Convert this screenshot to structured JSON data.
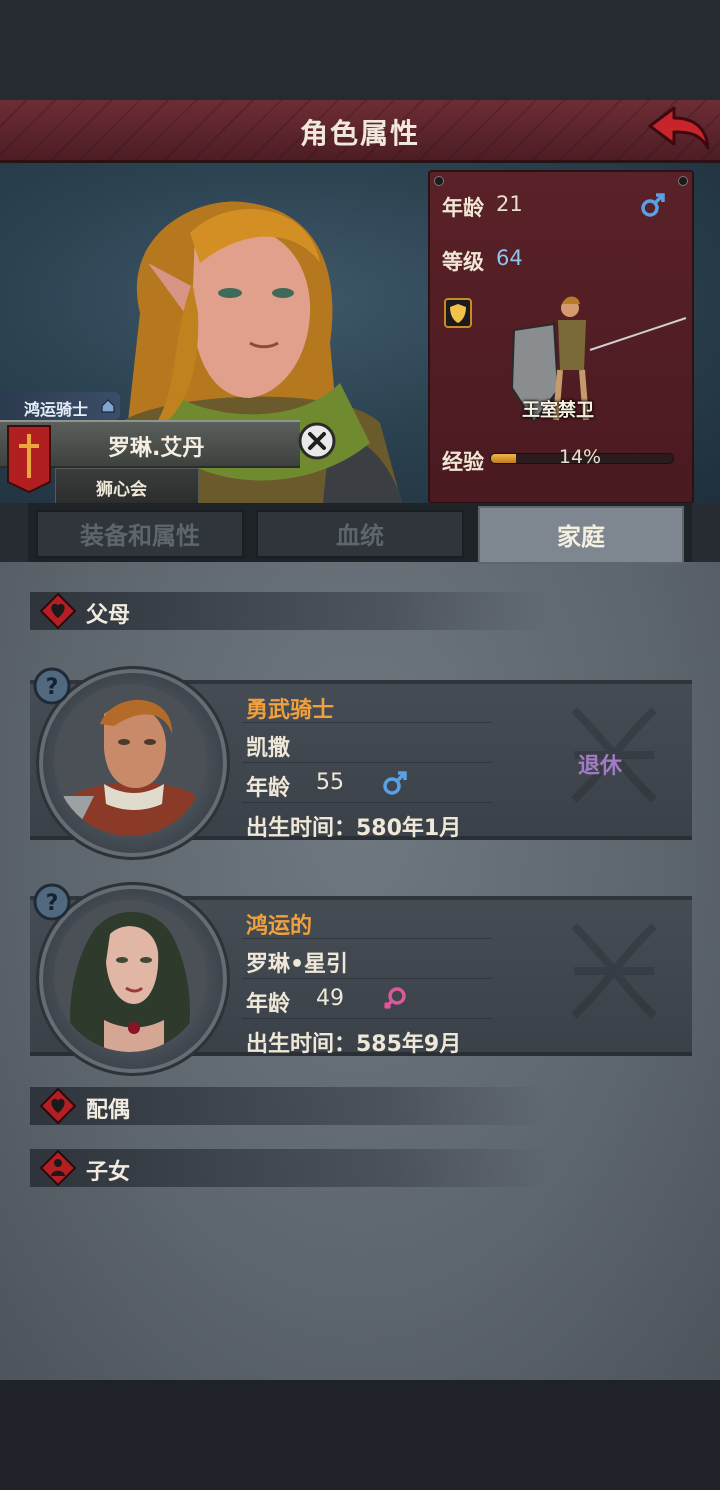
{
  "header": {
    "title": "角色属性"
  },
  "hero": {
    "class_badge": "鸿运骑士",
    "name": "罗琳.艾丹",
    "guild": "狮心会"
  },
  "stats": {
    "age_label": "年龄",
    "age_value": "21",
    "level_label": "等级",
    "level_value": "64",
    "unit_name": "王室禁卫",
    "xp_label": "经验",
    "xp_percent_text": "14%",
    "xp_fraction": 0.14
  },
  "tabs": [
    {
      "label": "装备和属性"
    },
    {
      "label": "血统"
    },
    {
      "label": "家庭"
    }
  ],
  "sections": {
    "parents": "父母",
    "spouse": "配偶",
    "children": "子女"
  },
  "parents": [
    {
      "title": "勇武骑士",
      "name": "凯撒",
      "age_label": "年龄",
      "age_value": "55",
      "birth": "出生时间：580年1月",
      "status": "退休",
      "gender": "male"
    },
    {
      "title": "鸿运的",
      "name": "罗琳•星引",
      "age_label": "年龄",
      "age_value": "49",
      "birth": "出生时间：585年9月",
      "gender": "female"
    }
  ],
  "colors": {
    "title_banner": "#5e242c",
    "stats_card": "#4f1d23",
    "orange_title": "#f0a03c",
    "retired_purple": "#a27bc4",
    "male_blue": "#5aa0e6",
    "female_pink": "#d75a9a"
  }
}
